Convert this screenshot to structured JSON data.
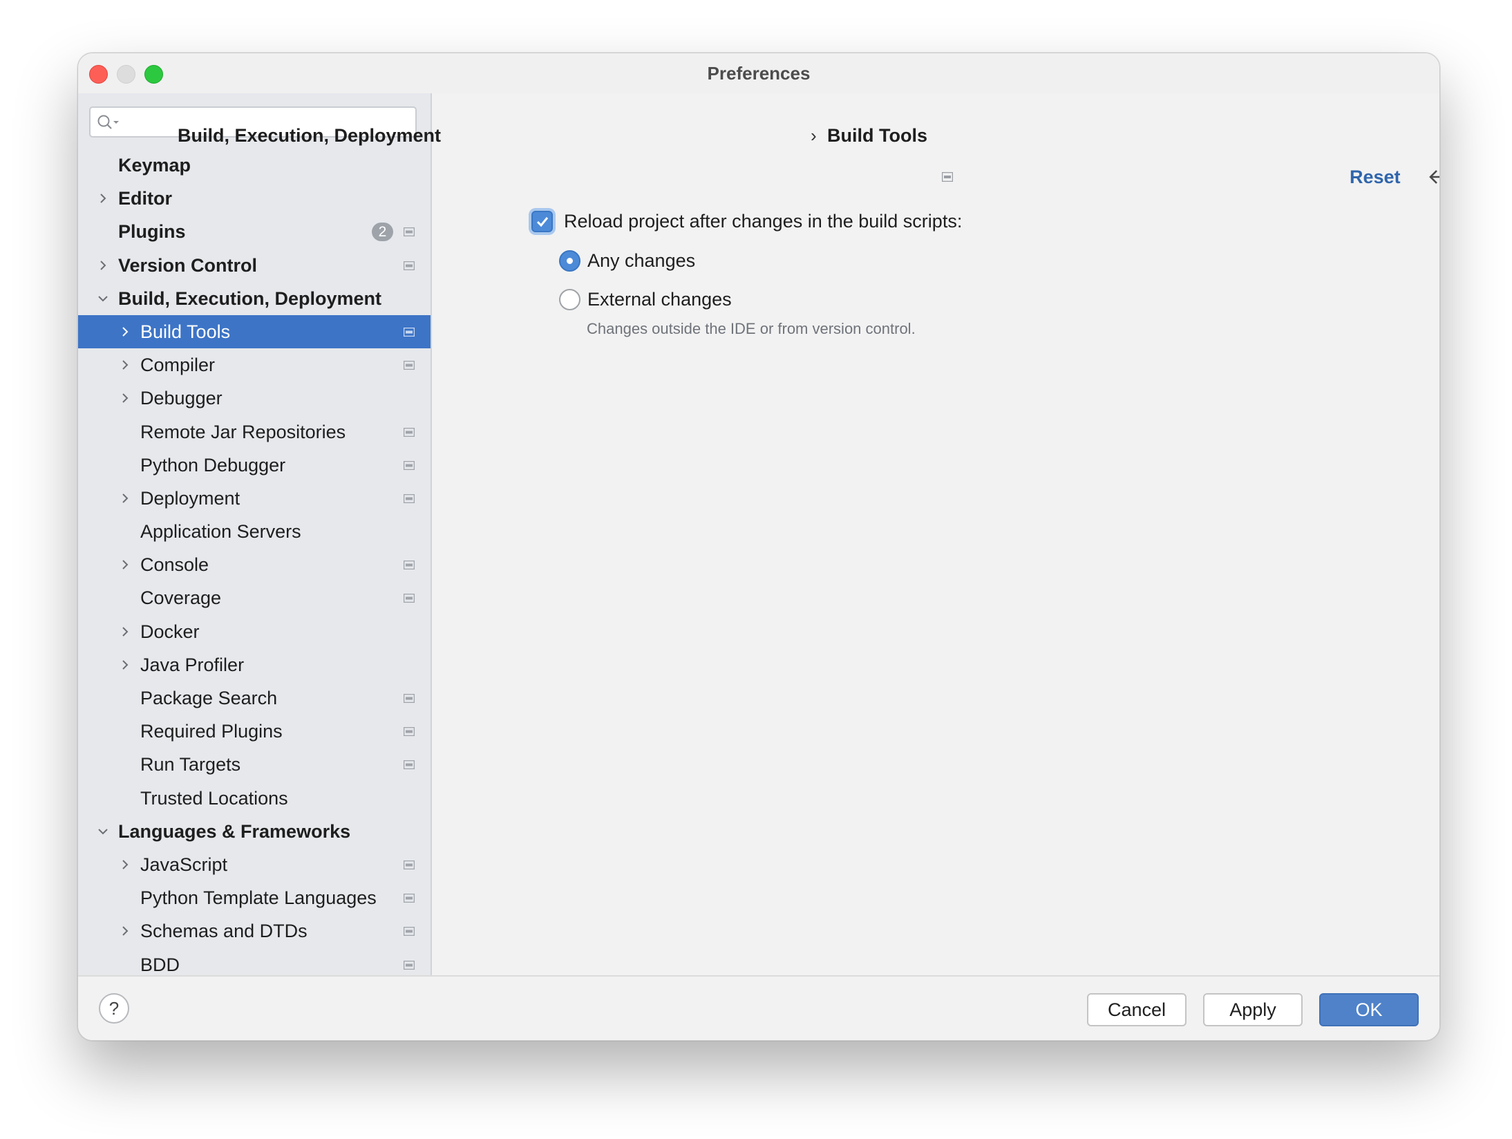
{
  "window": {
    "title": "Preferences"
  },
  "sidebar": {
    "search_placeholder": "",
    "items": [
      {
        "label": "Keymap",
        "level": 0,
        "bold": true,
        "chevron": "none",
        "pref_icon": false,
        "badge": ""
      },
      {
        "label": "Editor",
        "level": 0,
        "bold": true,
        "chevron": "right",
        "pref_icon": false,
        "badge": ""
      },
      {
        "label": "Plugins",
        "level": 0,
        "bold": true,
        "chevron": "none",
        "pref_icon": true,
        "badge": "2"
      },
      {
        "label": "Version Control",
        "level": 0,
        "bold": true,
        "chevron": "right",
        "pref_icon": true,
        "badge": ""
      },
      {
        "label": "Build, Execution, Deployment",
        "level": 0,
        "bold": true,
        "chevron": "down",
        "pref_icon": false,
        "badge": ""
      },
      {
        "label": "Build Tools",
        "level": 1,
        "bold": false,
        "chevron": "right",
        "pref_icon": true,
        "badge": "",
        "selected": true
      },
      {
        "label": "Compiler",
        "level": 1,
        "bold": false,
        "chevron": "right",
        "pref_icon": true,
        "badge": ""
      },
      {
        "label": "Debugger",
        "level": 1,
        "bold": false,
        "chevron": "right",
        "pref_icon": false,
        "badge": ""
      },
      {
        "label": "Remote Jar Repositories",
        "level": 1,
        "bold": false,
        "chevron": "none",
        "pref_icon": true,
        "badge": ""
      },
      {
        "label": "Python Debugger",
        "level": 1,
        "bold": false,
        "chevron": "none",
        "pref_icon": true,
        "badge": ""
      },
      {
        "label": "Deployment",
        "level": 1,
        "bold": false,
        "chevron": "right",
        "pref_icon": true,
        "badge": ""
      },
      {
        "label": "Application Servers",
        "level": 1,
        "bold": false,
        "chevron": "none",
        "pref_icon": false,
        "badge": ""
      },
      {
        "label": "Console",
        "level": 1,
        "bold": false,
        "chevron": "right",
        "pref_icon": true,
        "badge": ""
      },
      {
        "label": "Coverage",
        "level": 1,
        "bold": false,
        "chevron": "none",
        "pref_icon": true,
        "badge": ""
      },
      {
        "label": "Docker",
        "level": 1,
        "bold": false,
        "chevron": "right",
        "pref_icon": false,
        "badge": ""
      },
      {
        "label": "Java Profiler",
        "level": 1,
        "bold": false,
        "chevron": "right",
        "pref_icon": false,
        "badge": ""
      },
      {
        "label": "Package Search",
        "level": 1,
        "bold": false,
        "chevron": "none",
        "pref_icon": true,
        "badge": ""
      },
      {
        "label": "Required Plugins",
        "level": 1,
        "bold": false,
        "chevron": "none",
        "pref_icon": true,
        "badge": ""
      },
      {
        "label": "Run Targets",
        "level": 1,
        "bold": false,
        "chevron": "none",
        "pref_icon": true,
        "badge": ""
      },
      {
        "label": "Trusted Locations",
        "level": 1,
        "bold": false,
        "chevron": "none",
        "pref_icon": false,
        "badge": ""
      },
      {
        "label": "Languages & Frameworks",
        "level": 0,
        "bold": true,
        "chevron": "down",
        "pref_icon": false,
        "badge": ""
      },
      {
        "label": "JavaScript",
        "level": 1,
        "bold": false,
        "chevron": "right",
        "pref_icon": true,
        "badge": ""
      },
      {
        "label": "Python Template Languages",
        "level": 1,
        "bold": false,
        "chevron": "none",
        "pref_icon": true,
        "badge": ""
      },
      {
        "label": "Schemas and DTDs",
        "level": 1,
        "bold": false,
        "chevron": "right",
        "pref_icon": true,
        "badge": ""
      },
      {
        "label": "BDD",
        "level": 1,
        "bold": false,
        "chevron": "none",
        "pref_icon": true,
        "badge": ""
      }
    ]
  },
  "content": {
    "breadcrumb": {
      "parent": "Build, Execution, Deployment",
      "separator": "›",
      "current": "Build Tools"
    },
    "reset_label": "Reset",
    "reload_checkbox": {
      "label": "Reload project after changes in the build scripts:",
      "checked": true
    },
    "radio_any": {
      "label": "Any changes",
      "selected": true
    },
    "radio_external": {
      "label": "External changes",
      "selected": false
    },
    "external_hint": "Changes outside the IDE or from version control."
  },
  "footer": {
    "help_label": "?",
    "cancel_label": "Cancel",
    "apply_label": "Apply",
    "ok_label": "OK"
  },
  "colors": {
    "selection": "#3d74c6",
    "accent": "#4c8ad8",
    "link": "#2f65ac",
    "ok_button": "#4f82c9"
  }
}
